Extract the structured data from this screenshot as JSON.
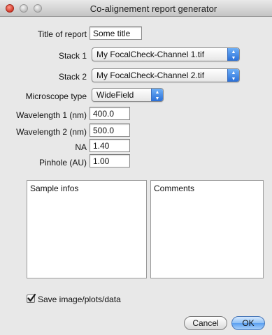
{
  "window": {
    "title": "Co-alignement report generator"
  },
  "form": {
    "title_label": "Title of report",
    "title_value": "Some title",
    "stack1_label": "Stack 1",
    "stack1_value": "My FocalCheck-Channel 1.tif",
    "stack2_label": "Stack 2",
    "stack2_value": "My FocalCheck-Channel 2.tif",
    "microscope_label": "Microscope type",
    "microscope_value": "WideField",
    "wl1_label": "Wavelength 1 (nm)",
    "wl1_value": "400.0",
    "wl2_label": "Wavelength 2 (nm)",
    "wl2_value": "500.0",
    "na_label": "NA",
    "na_value": "1.40",
    "pinhole_label": "Pinhole (AU)",
    "pinhole_value": "1.00",
    "sample_infos_text": "Sample infos",
    "comments_text": "Comments",
    "save_checkbox_label": "Save image/plots/data",
    "save_checked": true
  },
  "buttons": {
    "cancel": "Cancel",
    "ok": "OK"
  },
  "icons": {
    "window_close": "close-icon",
    "window_minimize": "minimize-icon",
    "window_zoom": "zoom-icon",
    "select_arrows": "updown-arrows-icon",
    "check": "checkmark-icon"
  },
  "colors": {
    "accent": "#3b82e8",
    "window_bg": "#e8e8e8",
    "close_red": "#d33a2a"
  }
}
